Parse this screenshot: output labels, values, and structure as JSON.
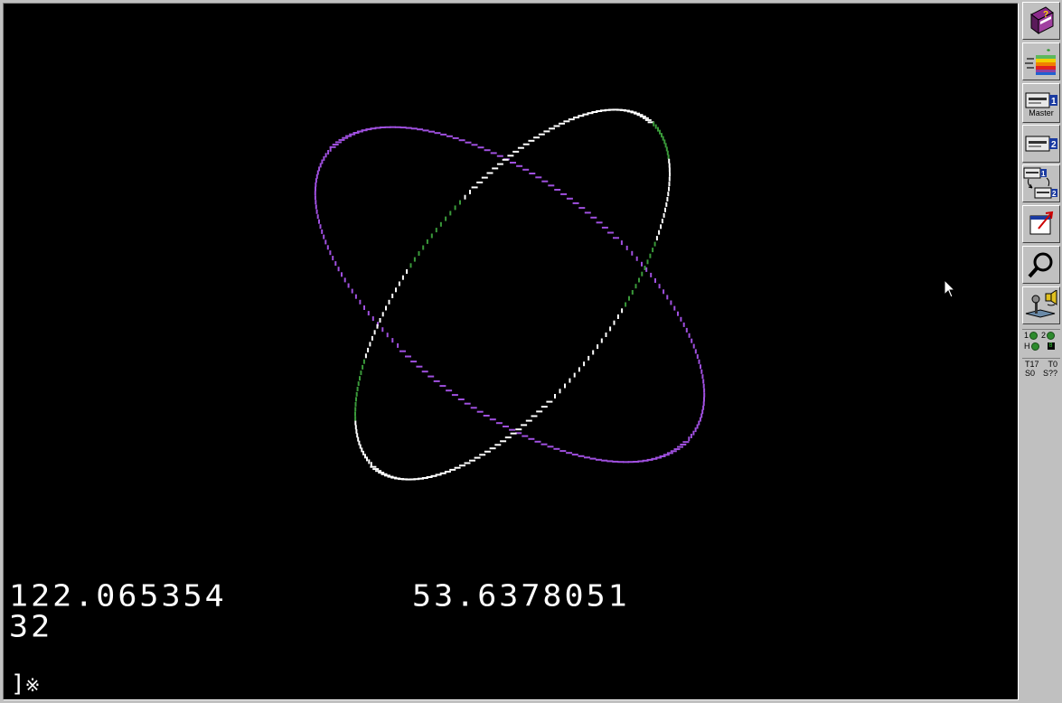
{
  "screen": {
    "background": "#000000",
    "readout_x": "122.065354",
    "readout_y": "53.6378051",
    "readout_count": "32",
    "prompt_glyph": "]",
    "prompt_char": "※"
  },
  "orbits": {
    "colors": {
      "white": "#ffffff",
      "violet": "#a050e0",
      "green": "#3a9a3a"
    }
  },
  "toolbar": {
    "buttons": [
      {
        "name": "help-book-button",
        "icon": "help-book-icon",
        "label": ""
      },
      {
        "name": "run-button",
        "icon": "apple-logo-icon",
        "label": ""
      },
      {
        "name": "drive-1-master-button",
        "icon": "disk-drive-1-icon",
        "label": "Master"
      },
      {
        "name": "drive-2-button",
        "icon": "disk-drive-2-icon",
        "label": ""
      },
      {
        "name": "swap-drives-button",
        "icon": "swap-drives-icon",
        "label": ""
      },
      {
        "name": "fullscreen-button",
        "icon": "window-resize-icon",
        "label": ""
      },
      {
        "name": "debugger-button",
        "icon": "magnifier-icon",
        "label": ""
      },
      {
        "name": "settings-button",
        "icon": "joystick-sound-icon",
        "label": ""
      }
    ],
    "leds": {
      "row1_a": "1",
      "row1_b": "2",
      "row2_a": "H",
      "row2_b": "8"
    },
    "info": {
      "t_label": "T17",
      "t0_label": "T0",
      "s_label": "S0",
      "s_unknown": "S??"
    }
  }
}
